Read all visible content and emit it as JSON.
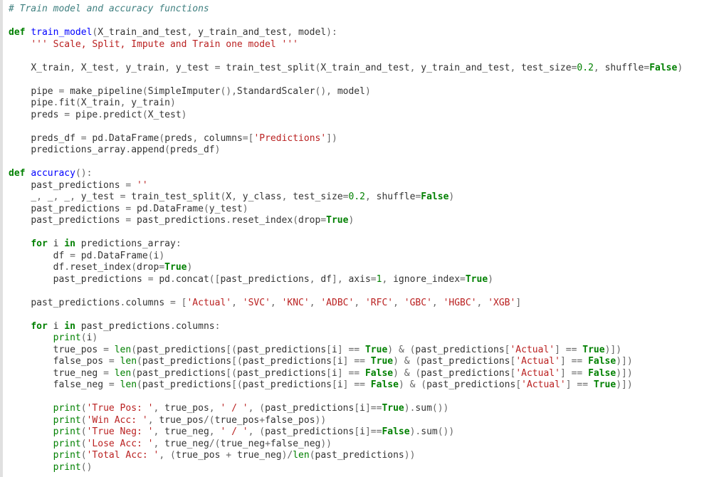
{
  "code": {
    "head_comment": "# Train model and accuracy functions",
    "parts": {
      "def": "def",
      "for": "for",
      "in": "in",
      "fn_train_model": "train_model",
      "fn_accuracy": "accuracy",
      "p_X_train_and_test": "X_train_and_test",
      "p_y_train_and_test": "y_train_and_test",
      "p_model": "model",
      "docstring1": "''' Scale, Split, Impute and Train one model '''",
      "id_X_train": "X_train",
      "id_X_test": "X_test",
      "id_y_train": "y_train",
      "id_y_test": "y_test",
      "id_train_test_split": "train_test_split",
      "id_test_size": "test_size",
      "n_0_2": "0.2",
      "id_shuffle": "shuffle",
      "b_False": "False",
      "b_True": "True",
      "id_pipe": "pipe",
      "id_make_pipeline": "make_pipeline",
      "id_SimpleImputer": "SimpleImputer",
      "id_StandardScaler": "StandardScaler",
      "id_fit": "fit",
      "id_preds": "preds",
      "id_predict": "predict",
      "id_preds_df": "preds_df",
      "id_pd": "pd",
      "id_DataFrame": "DataFrame",
      "id_columns": "columns",
      "s_Predictions": "'Predictions'",
      "id_predictions_array": "predictions_array",
      "id_append": "append",
      "id_past_predictions": "past_predictions",
      "s_empty": "''",
      "id_underscore": "_",
      "id_X": "X",
      "id_y_class": "y_class",
      "id_reset_index": "reset_index",
      "id_drop": "drop",
      "id_i": "i",
      "id_df": "df",
      "id_concat": "concat",
      "id_axis": "axis",
      "n_1": "1",
      "id_ignore_index": "ignore_index",
      "s_Actual": "'Actual'",
      "s_SVC": "'SVC'",
      "s_KNC": "'KNC'",
      "s_ADBC": "'ADBC'",
      "s_RFC": "'RFC'",
      "s_GBC": "'GBC'",
      "s_HGBC": "'HGBC'",
      "s_XGB": "'XGB'",
      "bi_print": "print",
      "id_true_pos": "true_pos",
      "bi_len": "len",
      "id_false_pos": "false_pos",
      "id_true_neg": "true_neg",
      "id_false_neg": "false_neg",
      "s_TruePos": "'True Pos: '",
      "s_slash": "' / '",
      "id_sum": "sum",
      "s_WinAcc": "'Win Acc: '",
      "s_TrueNeg": "'True Neg: '",
      "s_LoseAcc": "'Lose Acc: '",
      "s_TotalAcc": "'Total Acc: '"
    }
  }
}
